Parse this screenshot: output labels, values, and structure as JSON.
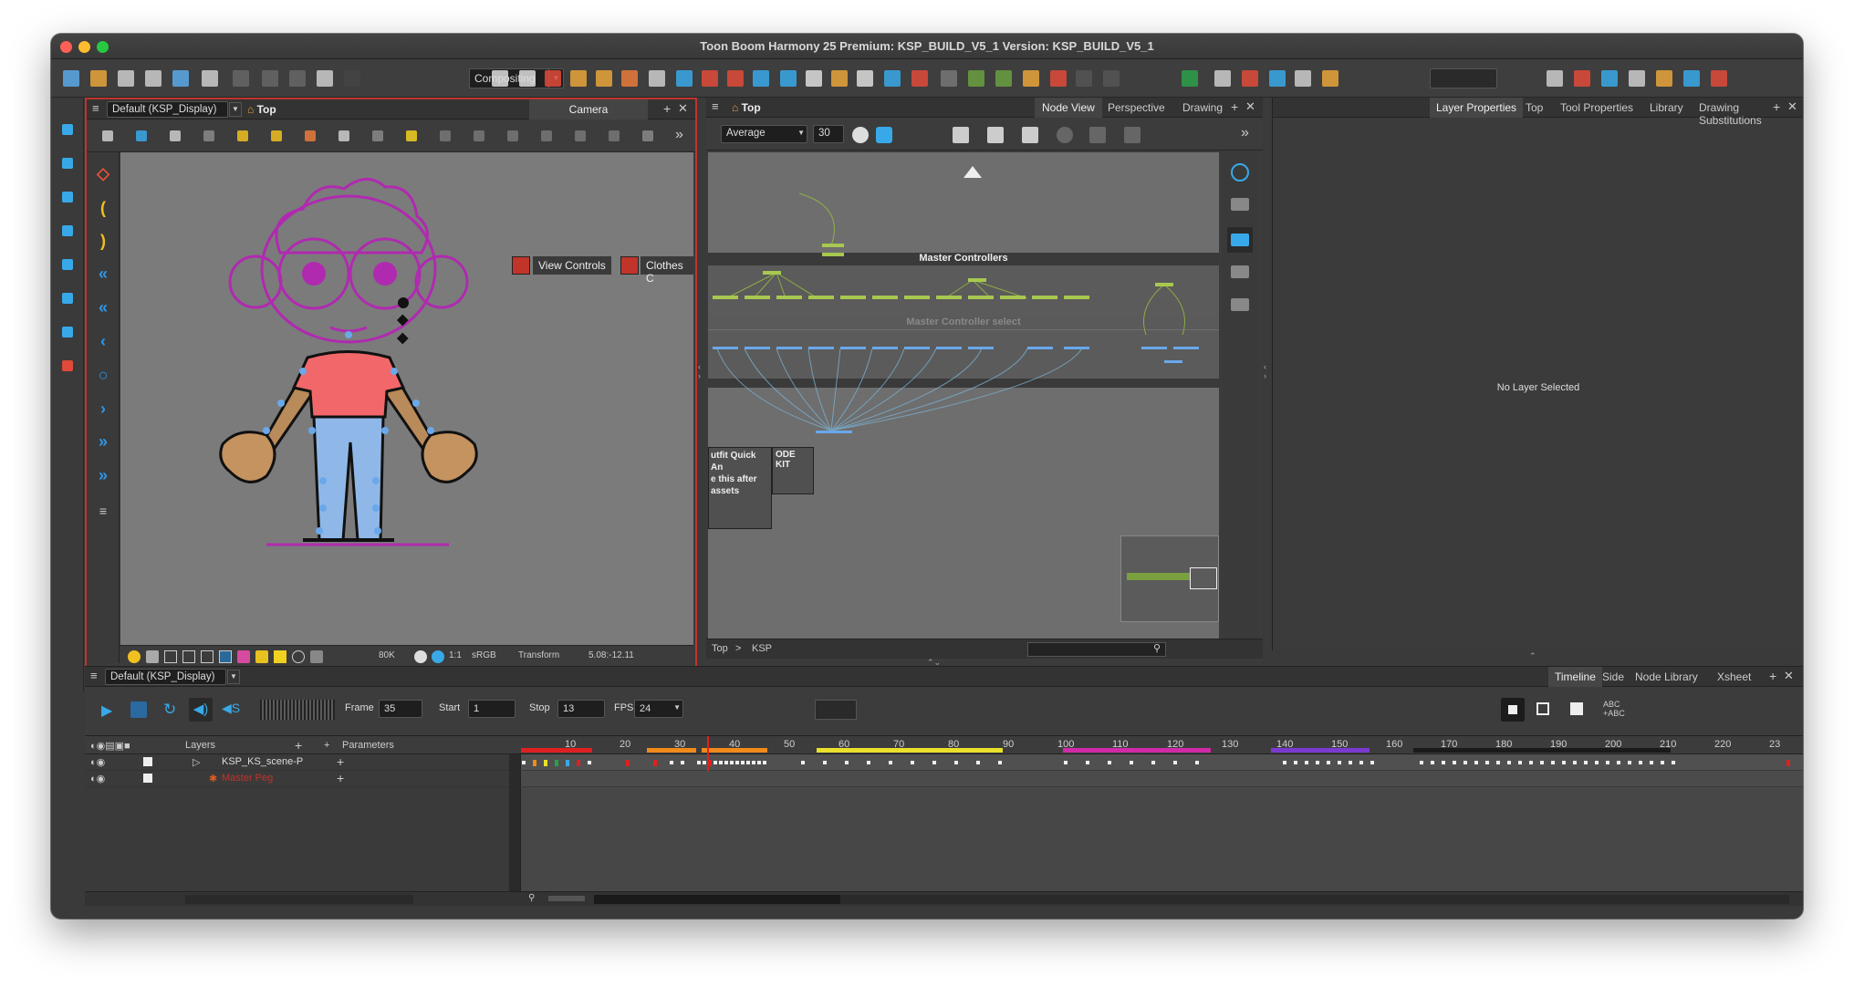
{
  "window": {
    "title": "Toon Boom Harmony 25 Premium: KSP_BUILD_V5_1 Version: KSP_BUILD_V5_1"
  },
  "toolbar": {
    "workspace_select": "Compositing",
    "icons": [
      "new-icon",
      "open-icon",
      "save-icon",
      "save-all-icon",
      "import-icon",
      "undo-icon",
      "redo-icon",
      "cut-icon",
      "copy-icon",
      "paste-icon",
      "delete-icon",
      "select-icon",
      "contour-editor-icon",
      "brush-icon",
      "pencil-icon",
      "paint-icon",
      "eraser-icon",
      "text-icon",
      "rectangle-icon",
      "ellipse-icon",
      "dropper-icon",
      "pivot-icon",
      "morph-icon",
      "hand-icon",
      "transform-icon",
      "bounding-box-icon",
      "stroke-icon",
      "ink-icon",
      "rigging-icon",
      "peg-icon",
      "bone-icon",
      "deform-icon",
      "grid-icon",
      "snap-icon",
      "layer-icon",
      "onion-icon",
      "light-icon",
      "function-icon",
      "brush-color-icon",
      "magic-wand-icon",
      "cutter-icon"
    ]
  },
  "camera_view": {
    "display_select": "Default (KSP_Display)",
    "top_label": "Top",
    "tab_label": "Camera",
    "overlay_buttons": [
      "View Controls",
      "Clothes C"
    ],
    "status": {
      "zoom": "80K",
      "color_space": "sRGB",
      "ratio": "1:1",
      "tool": "Transform",
      "coords": "5.08:-12.11"
    }
  },
  "node_view": {
    "top_label": "Top",
    "tabs": [
      "Node View",
      "Perspective",
      "Drawing"
    ],
    "active_tab": "Node View",
    "blend_select": "Average",
    "blend_value": "30",
    "groups": {
      "master": "Master Controllers",
      "select": "Master Controller select",
      "outfit": "utfit Quick An",
      "outfit_line2": "e this after",
      "outfit_line3": "assets",
      "node_kit": "ODE KIT"
    },
    "breadcrumb": [
      "Top",
      "KSP"
    ]
  },
  "right_panel": {
    "tabs": [
      "Layer Properties",
      "Top",
      "Tool Properties",
      "Library",
      "Drawing Substitutions"
    ],
    "active_tab": "Layer Properties",
    "empty_message": "No Layer Selected"
  },
  "timeline": {
    "display_select": "Default (KSP_Display)",
    "tabs": [
      "Timeline",
      "Side",
      "Node Library",
      "Xsheet"
    ],
    "active_tab": "Timeline",
    "frame_label": "Frame",
    "frame_value": "35",
    "start_label": "Start",
    "start_value": "1",
    "stop_label": "Stop",
    "stop_value": "13",
    "fps_label": "FPS",
    "fps_value": "24",
    "layers_header": "Layers",
    "parameters_header": "Parameters",
    "layers": [
      {
        "name": "KSP_KS_scene-P",
        "color": "#dddddd"
      },
      {
        "name": "Master Peg",
        "color": "#c0342a"
      }
    ],
    "ruler_ticks": [
      "10",
      "20",
      "30",
      "40",
      "50",
      "60",
      "70",
      "80",
      "90",
      "100",
      "110",
      "120",
      "130",
      "140",
      "150",
      "160",
      "170",
      "180",
      "190",
      "200",
      "210",
      "220",
      "23"
    ],
    "scene_markers": [
      {
        "color": "#e02020",
        "start": 1,
        "end": 14
      },
      {
        "color": "#f08a1a",
        "start": 24,
        "end": 33
      },
      {
        "color": "#f08a1a",
        "start": 34,
        "end": 46
      },
      {
        "color": "#e8e02a",
        "start": 55,
        "end": 89
      },
      {
        "color": "#d02aa8",
        "start": 100,
        "end": 127
      },
      {
        "color": "#7a3ad0",
        "start": 138,
        "end": 156
      },
      {
        "color": "#1a1a1a",
        "start": 164,
        "end": 211
      }
    ],
    "playhead_frame": 35,
    "frame_range": [
      1,
      232
    ]
  }
}
